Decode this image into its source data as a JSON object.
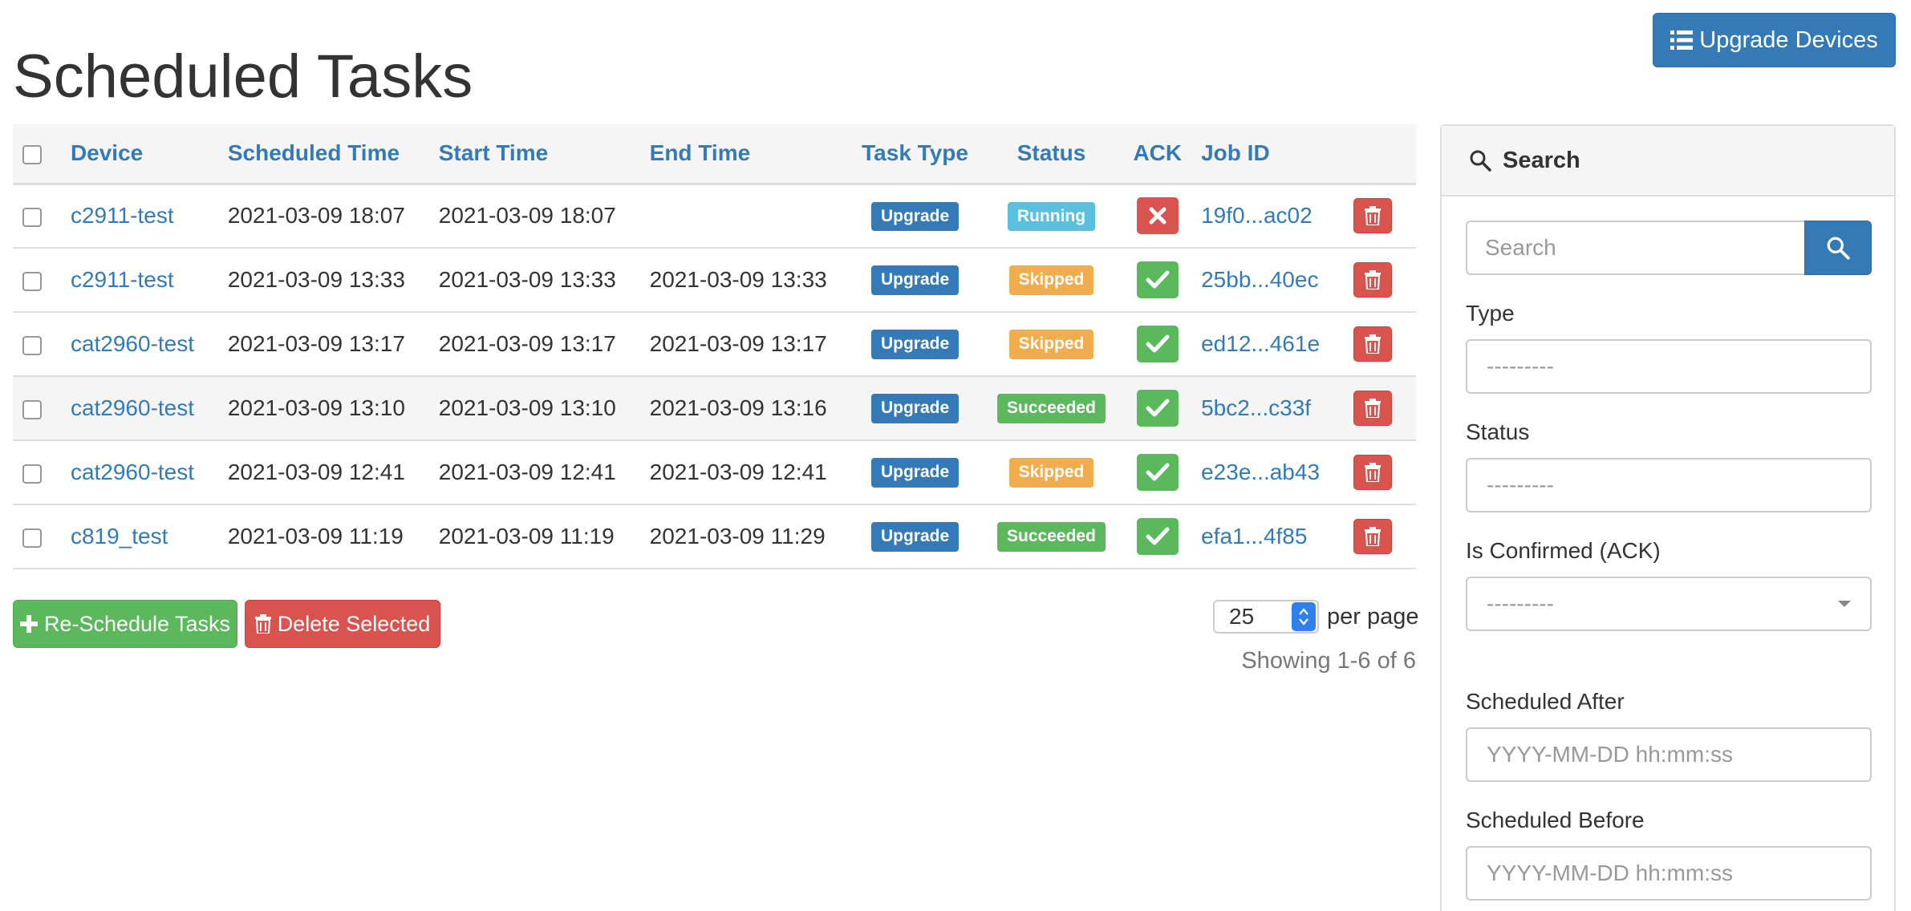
{
  "header": {
    "title": "Scheduled Tasks",
    "upgrade_button": "Upgrade Devices"
  },
  "table": {
    "columns": [
      "Device",
      "Scheduled Time",
      "Start Time",
      "End Time",
      "Task Type",
      "Status",
      "ACK",
      "Job ID"
    ],
    "rows": [
      {
        "device": "c2911-test",
        "scheduled": "2021-03-09 18:07",
        "start": "2021-03-09 18:07",
        "end": "",
        "type": "Upgrade",
        "status": "Running",
        "ack": false,
        "job": "19f0...ac02"
      },
      {
        "device": "c2911-test",
        "scheduled": "2021-03-09 13:33",
        "start": "2021-03-09 13:33",
        "end": "2021-03-09 13:33",
        "type": "Upgrade",
        "status": "Skipped",
        "ack": true,
        "job": "25bb...40ec"
      },
      {
        "device": "cat2960-test",
        "scheduled": "2021-03-09 13:17",
        "start": "2021-03-09 13:17",
        "end": "2021-03-09 13:17",
        "type": "Upgrade",
        "status": "Skipped",
        "ack": true,
        "job": "ed12...461e"
      },
      {
        "device": "cat2960-test",
        "scheduled": "2021-03-09 13:10",
        "start": "2021-03-09 13:10",
        "end": "2021-03-09 13:16",
        "type": "Upgrade",
        "status": "Succeeded",
        "ack": true,
        "job": "5bc2...c33f"
      },
      {
        "device": "cat2960-test",
        "scheduled": "2021-03-09 12:41",
        "start": "2021-03-09 12:41",
        "end": "2021-03-09 12:41",
        "type": "Upgrade",
        "status": "Skipped",
        "ack": true,
        "job": "e23e...ab43"
      },
      {
        "device": "c819_test",
        "scheduled": "2021-03-09 11:19",
        "start": "2021-03-09 11:19",
        "end": "2021-03-09 11:29",
        "type": "Upgrade",
        "status": "Succeeded",
        "ack": true,
        "job": "efa1...4f85"
      }
    ]
  },
  "actions": {
    "reschedule": "Re-Schedule Tasks",
    "delete_selected": "Delete Selected"
  },
  "pagination": {
    "per_page_value": "25",
    "per_page_label": "per page",
    "showing": "Showing 1-6 of 6"
  },
  "search_panel": {
    "title": "Search",
    "search_placeholder": "Search",
    "type_label": "Type",
    "type_value": "---------",
    "status_label": "Status",
    "status_value": "---------",
    "ack_label": "Is Confirmed (ACK)",
    "ack_value": "---------",
    "after_label": "Scheduled After",
    "after_placeholder": "YYYY-MM-DD hh:mm:ss",
    "before_label": "Scheduled Before",
    "before_placeholder": "YYYY-MM-DD hh:mm:ss"
  },
  "colors": {
    "primary": "#337ab7",
    "success": "#5cb85c",
    "danger": "#d9534f",
    "info": "#5bc0de",
    "warning": "#f0ad4e"
  },
  "status_colors": {
    "Running": "#5bc0de",
    "Skipped": "#f0ad4e",
    "Succeeded": "#5cb85c"
  }
}
